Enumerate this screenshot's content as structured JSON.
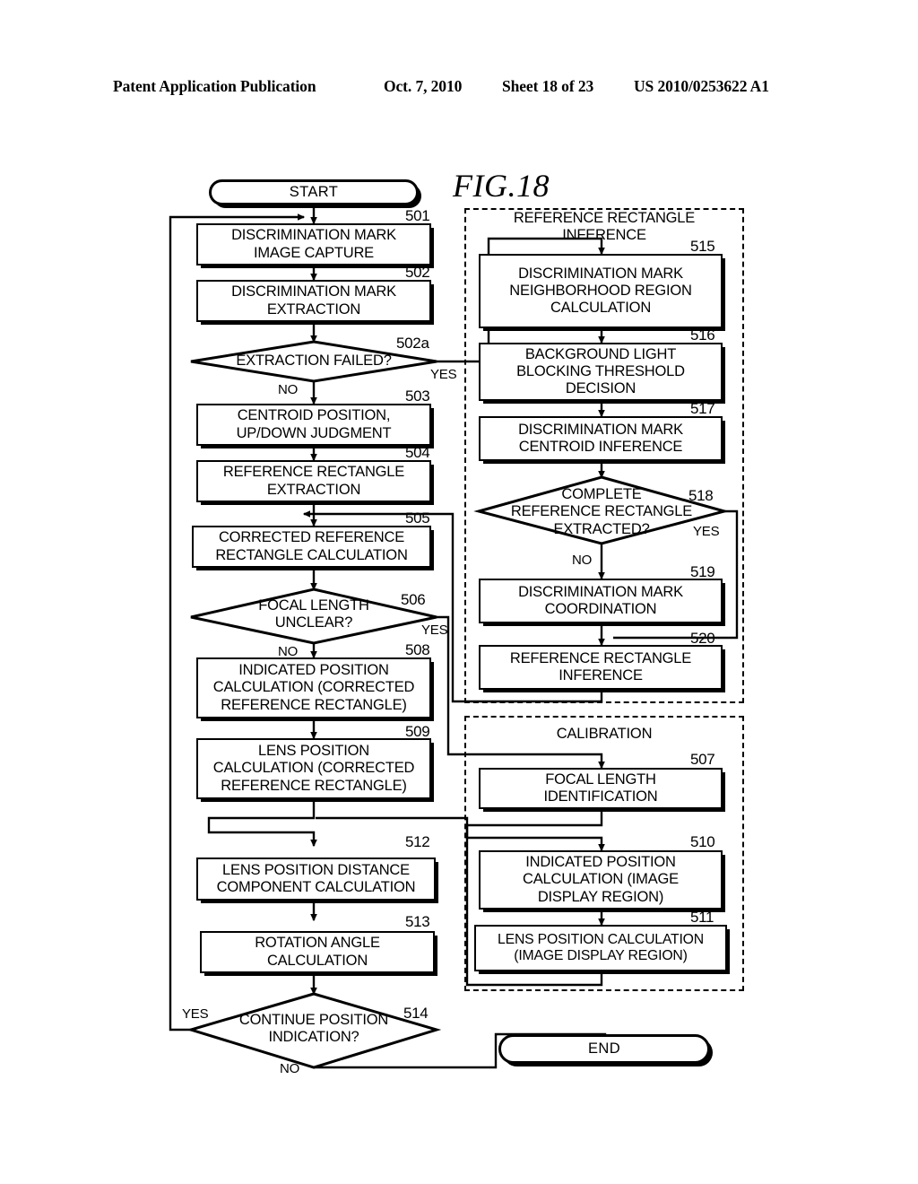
{
  "header": {
    "publication": "Patent Application Publication",
    "date": "Oct. 7, 2010",
    "sheet": "Sheet 18 of 23",
    "number": "US 2010/0253622 A1"
  },
  "figure": {
    "label": "FIG.18"
  },
  "terminators": {
    "start": "START",
    "end": "END"
  },
  "groups": [
    {
      "id": "reference-rectangle-inference",
      "title": "REFERENCE RECTANGLE\nINFERENCE"
    },
    {
      "id": "calibration",
      "title": "CALIBRATION"
    }
  ],
  "branch_labels": {
    "yes": "YES",
    "no": "NO"
  },
  "nodes": [
    {
      "ref": "501",
      "type": "process",
      "text": "DISCRIMINATION MARK\nIMAGE CAPTURE"
    },
    {
      "ref": "502",
      "type": "process",
      "text": "DISCRIMINATION MARK\nEXTRACTION"
    },
    {
      "ref": "502a",
      "type": "decision",
      "text": "EXTRACTION FAILED?"
    },
    {
      "ref": "503",
      "type": "process",
      "text": "CENTROID POSITION,\nUP/DOWN JUDGMENT"
    },
    {
      "ref": "504",
      "type": "process",
      "text": "REFERENCE RECTANGLE\nEXTRACTION"
    },
    {
      "ref": "505",
      "type": "process",
      "text": "CORRECTED REFERENCE\nRECTANGLE CALCULATION"
    },
    {
      "ref": "506",
      "type": "decision",
      "text": "FOCAL LENGTH\nUNCLEAR?"
    },
    {
      "ref": "508",
      "type": "process",
      "text": "INDICATED POSITION\nCALCULATION (CORRECTED\nREFERENCE RECTANGLE)"
    },
    {
      "ref": "509",
      "type": "process",
      "text": "LENS POSITION\nCALCULATION (CORRECTED\nREFERENCE RECTANGLE)"
    },
    {
      "ref": "512",
      "type": "process",
      "text": "LENS POSITION DISTANCE\nCOMPONENT CALCULATION"
    },
    {
      "ref": "513",
      "type": "process",
      "text": "ROTATION ANGLE\nCALCULATION"
    },
    {
      "ref": "514",
      "type": "decision",
      "text": "CONTINUE POSITION\nINDICATION?"
    },
    {
      "ref": "515",
      "type": "process",
      "text": "DISCRIMINATION MARK\nNEIGHBORHOOD REGION\nCALCULATION"
    },
    {
      "ref": "516",
      "type": "process",
      "text": "BACKGROUND LIGHT\nBLOCKING THRESHOLD\nDECISION"
    },
    {
      "ref": "517",
      "type": "process",
      "text": "DISCRIMINATION MARK\nCENTROID INFERENCE"
    },
    {
      "ref": "518",
      "type": "decision",
      "text": "COMPLETE\nREFERENCE RECTANGLE\nEXTRACTED?"
    },
    {
      "ref": "519",
      "type": "process",
      "text": "DISCRIMINATION MARK\nCOORDINATION"
    },
    {
      "ref": "520",
      "type": "process",
      "text": "REFERENCE RECTANGLE\nINFERENCE"
    },
    {
      "ref": "507",
      "type": "process",
      "text": "FOCAL LENGTH\nIDENTIFICATION"
    },
    {
      "ref": "510",
      "type": "process",
      "text": "INDICATED POSITION\nCALCULATION (IMAGE\nDISPLAY REGION)"
    },
    {
      "ref": "511",
      "type": "process",
      "text": "LENS POSITION CALCULATION\n(IMAGE DISPLAY REGION)"
    }
  ]
}
